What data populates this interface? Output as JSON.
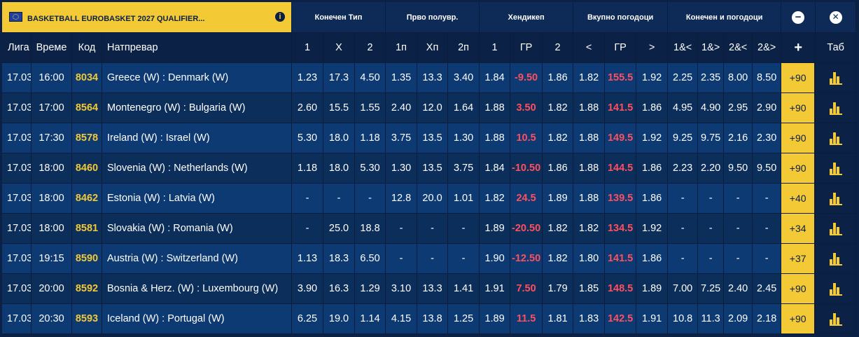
{
  "league": {
    "title": "BASKETBALL EUROBASKET 2027 QUALIFIER...",
    "info_glyph": "i",
    "flag_icon": "eu-flag-icon"
  },
  "groups": [
    "Конечен Тип",
    "Прво полувр.",
    "Хендикеп",
    "Вкупно погодоци",
    "Конечен и погодоци"
  ],
  "controls": {
    "collapse_glyph": "−",
    "close_glyph": "✕"
  },
  "columns": {
    "league": "Лига",
    "time": "Време",
    "code": "Код",
    "match": "Натпревар",
    "odds": [
      "1",
      "X",
      "2",
      "1п",
      "Xп",
      "2п",
      "1",
      "ГР",
      "2",
      "<",
      "ГР",
      ">",
      "1&<",
      "1&>",
      "2&<",
      "2&>"
    ],
    "more": "+",
    "tab": "Таб"
  },
  "colors": {
    "accent": "#f3c935",
    "background": "#0b2146",
    "row_odd": "#0d3a72",
    "row_even": "#0c2e5b",
    "line_red": "#ff4f5e"
  },
  "rows": [
    {
      "league": "17.03",
      "time": "16:00",
      "code": "8034",
      "match": "Greece (W) : Denmark (W)",
      "odds": [
        "1.23",
        "17.3",
        "4.50",
        "1.35",
        "13.3",
        "3.40",
        "1.84",
        "-9.50",
        "1.86",
        "1.82",
        "155.5",
        "1.92",
        "2.25",
        "2.35",
        "8.00",
        "8.50"
      ],
      "more": "+90"
    },
    {
      "league": "17.03",
      "time": "17:00",
      "code": "8564",
      "match": "Montenegro (W) : Bulgaria (W)",
      "odds": [
        "2.60",
        "15.5",
        "1.55",
        "2.40",
        "12.0",
        "1.64",
        "1.88",
        "3.50",
        "1.82",
        "1.88",
        "141.5",
        "1.86",
        "4.95",
        "4.90",
        "2.95",
        "2.90"
      ],
      "more": "+90"
    },
    {
      "league": "17.03",
      "time": "17:30",
      "code": "8578",
      "match": "Ireland (W) : Israel (W)",
      "odds": [
        "5.30",
        "18.0",
        "1.18",
        "3.75",
        "13.5",
        "1.30",
        "1.88",
        "10.5",
        "1.82",
        "1.88",
        "149.5",
        "1.92",
        "9.25",
        "9.75",
        "2.16",
        "2.30"
      ],
      "more": "+90"
    },
    {
      "league": "17.03",
      "time": "18:00",
      "code": "8460",
      "match": "Slovenia (W) : Netherlands (W)",
      "odds": [
        "1.18",
        "18.0",
        "5.30",
        "1.30",
        "13.5",
        "3.75",
        "1.84",
        "-10.50",
        "1.86",
        "1.88",
        "144.5",
        "1.86",
        "2.23",
        "2.20",
        "9.50",
        "9.50"
      ],
      "more": "+90"
    },
    {
      "league": "17.03",
      "time": "18:00",
      "code": "8462",
      "match": "Estonia (W) : Latvia (W)",
      "odds": [
        "-",
        "-",
        "-",
        "12.8",
        "20.0",
        "1.01",
        "1.82",
        "24.5",
        "1.89",
        "1.88",
        "139.5",
        "1.86",
        "-",
        "-",
        "-",
        "-"
      ],
      "more": "+40"
    },
    {
      "league": "17.03",
      "time": "18:00",
      "code": "8581",
      "match": "Slovakia (W) : Romania (W)",
      "odds": [
        "-",
        "25.0",
        "18.8",
        "-",
        "-",
        "-",
        "1.89",
        "-20.50",
        "1.82",
        "1.82",
        "134.5",
        "1.92",
        "-",
        "-",
        "-",
        "-"
      ],
      "more": "+34"
    },
    {
      "league": "17.03",
      "time": "19:15",
      "code": "8590",
      "match": "Austria (W) : Switzerland (W)",
      "odds": [
        "1.13",
        "18.3",
        "6.50",
        "-",
        "-",
        "-",
        "1.90",
        "-12.50",
        "1.82",
        "1.80",
        "141.5",
        "1.86",
        "-",
        "-",
        "-",
        "-"
      ],
      "more": "+37"
    },
    {
      "league": "17.03",
      "time": "20:00",
      "code": "8592",
      "match": "Bosnia & Herz. (W) : Luxembourg (W)",
      "odds": [
        "3.90",
        "16.3",
        "1.29",
        "3.10",
        "13.3",
        "1.41",
        "1.91",
        "7.50",
        "1.79",
        "1.85",
        "148.5",
        "1.89",
        "7.00",
        "7.25",
        "2.40",
        "2.45"
      ],
      "more": "+90"
    },
    {
      "league": "17.03",
      "time": "20:30",
      "code": "8593",
      "match": "Iceland (W) : Portugal (W)",
      "odds": [
        "6.25",
        "19.0",
        "1.14",
        "4.15",
        "13.8",
        "1.25",
        "1.89",
        "11.5",
        "1.81",
        "1.83",
        "142.5",
        "1.91",
        "10.8",
        "11.3",
        "2.09",
        "2.18"
      ],
      "more": "+90"
    }
  ]
}
